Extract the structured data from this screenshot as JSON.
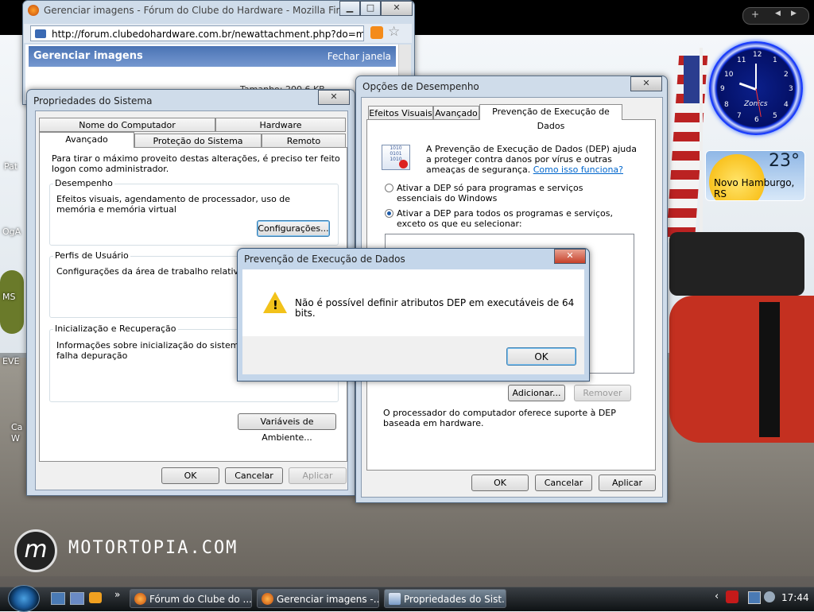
{
  "desktop": {
    "labels": [
      "Pat",
      "OgA",
      "MS",
      "EVE",
      "Ca",
      "W"
    ],
    "branding": {
      "logo_letter": "m",
      "text": "MOTORTOPIA.COM"
    }
  },
  "clock_gadget": {
    "brand": "Zonics",
    "numbers": [
      "12",
      "1",
      "2",
      "3",
      "4",
      "5",
      "6",
      "7",
      "8",
      "9",
      "10",
      "11"
    ]
  },
  "weather_gadget": {
    "temperature": "23°",
    "city": "Novo Hamburgo, RS"
  },
  "sidebar_controls": {
    "add": "+",
    "prev": "◀",
    "next": "▶"
  },
  "firefox": {
    "title": "Gerenciar imagens - Fórum do Clube do Hardware - Mozilla Firefox",
    "url": "http://forum.clubedohardware.com.br/newattachment.php?do=managea",
    "page_title": "Gerenciar imagens",
    "close_link": "Fechar janela",
    "behind_text": "Tamanho: 200,6 KB"
  },
  "system_props": {
    "title": "Propriedades do Sistema",
    "tabs_top": [
      "Nome do Computador",
      "Hardware"
    ],
    "tabs_bottom": [
      "Avançado",
      "Proteção do Sistema",
      "Remoto"
    ],
    "intro": "Para tirar o máximo proveito destas alterações, é preciso ter feito logon como administrador.",
    "performance": {
      "label": "Desempenho",
      "text": "Efeitos visuais, agendamento de processador, uso de memória e memória virtual",
      "button": "Configurações..."
    },
    "profiles": {
      "label": "Perfis de Usuário",
      "text": "Configurações da área de trabalho relativas ao s"
    },
    "startup": {
      "label": "Inicialização e Recuperação",
      "text": "Informações sobre inicialização do sistema, falha depuração"
    },
    "env_button": "Variáveis de Ambiente...",
    "ok": "OK",
    "cancel": "Cancelar",
    "apply": "Aplicar"
  },
  "perf_options": {
    "title": "Opções de Desempenho",
    "tabs": [
      "Efeitos Visuais",
      "Avançado",
      "Prevenção de Execução de Dados"
    ],
    "description": "A Prevenção de Execução de Dados (DEP) ajuda a proteger contra danos por vírus e outras ameaças de segurança.",
    "link": "Como isso funciona?",
    "radio1": "Ativar a DEP só para programas e serviços essenciais do Windows",
    "radio2": "Ativar a DEP para todos os programas e serviços, exceto os que eu selecionar:",
    "add_button": "Adicionar...",
    "remove_button": "Remover",
    "footer": "O processador do computador oferece suporte à DEP baseada em hardware.",
    "ok": "OK",
    "cancel": "Cancelar",
    "apply": "Aplicar"
  },
  "dep_dialog": {
    "title": "Prevenção de Execução de Dados",
    "message": "Não é possível definir atributos DEP em executáveis de 64 bits.",
    "ok": "OK"
  },
  "taskbar": {
    "buttons": [
      "Fórum do Clube do ...",
      "Gerenciar imagens -...",
      "Propriedades do Sist..."
    ],
    "time": "17:44",
    "chevron": "»"
  }
}
